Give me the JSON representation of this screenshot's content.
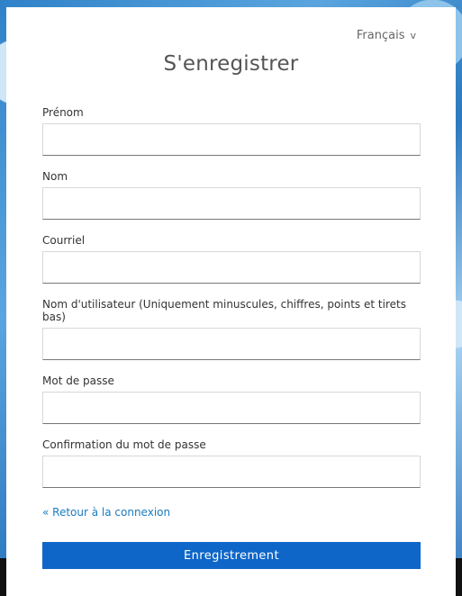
{
  "language_selector": {
    "label": "Français",
    "chevron": "v"
  },
  "title": "S'enregistrer",
  "fields": [
    {
      "label": "Prénom",
      "value": "",
      "type": "text"
    },
    {
      "label": "Nom",
      "value": "",
      "type": "text"
    },
    {
      "label": "Courriel",
      "value": "",
      "type": "email"
    },
    {
      "label": "Nom d'utilisateur (Uniquement minuscules, chiffres, points et tirets bas)",
      "value": "",
      "type": "text"
    },
    {
      "label": "Mot de passe",
      "value": "",
      "type": "password"
    },
    {
      "label": "Confirmation du mot de passe",
      "value": "",
      "type": "password"
    }
  ],
  "back_link": "« Retour à la connexion",
  "submit_label": "Enregistrement",
  "colors": {
    "accent": "#0e66c8",
    "link": "#1a7bbf",
    "background": "#1f6fb8"
  }
}
